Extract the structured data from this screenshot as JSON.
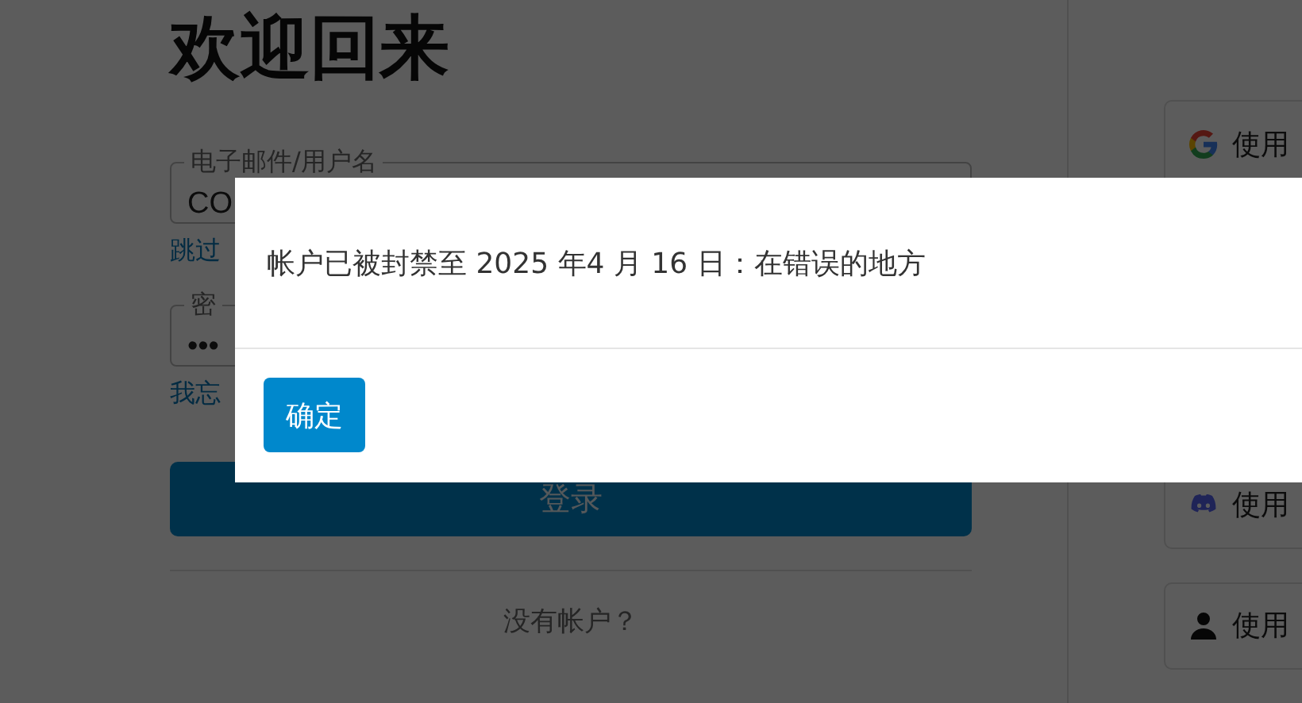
{
  "heading": "欢迎回来",
  "login_form": {
    "username": {
      "label": "电子邮件/用户名",
      "value": "CO"
    },
    "skip_link": "跳过",
    "password": {
      "label": "密",
      "value": "•••"
    },
    "forgot_link": "我忘",
    "submit": "登录",
    "signup_prompt": "没有帐户？"
  },
  "providers": [
    {
      "kind": "google",
      "label": "使用"
    },
    {
      "kind": "discord",
      "label": "使用"
    },
    {
      "kind": "person",
      "label": "使用"
    }
  ],
  "dialog": {
    "message": "帐户已被封禁至 2025 年4 月 16 日：在错误的地方",
    "buttons": [
      "确定"
    ]
  }
}
